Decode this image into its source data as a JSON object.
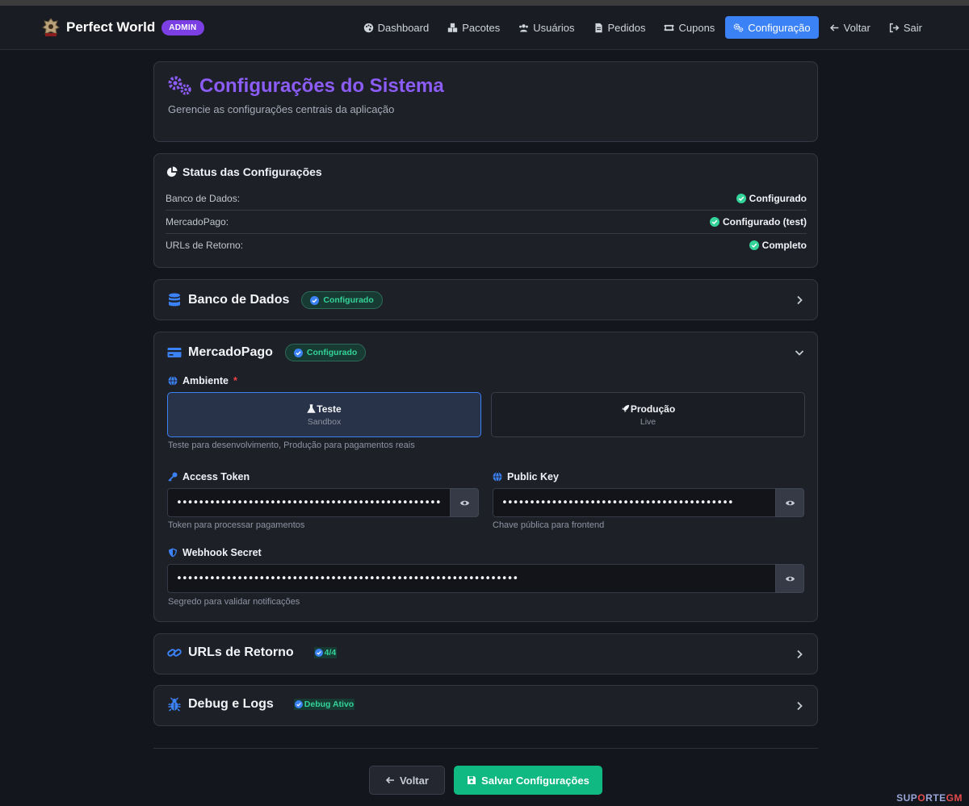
{
  "navbar": {
    "brand": "Perfect World",
    "badge": "ADMIN",
    "links": [
      {
        "label": "Dashboard",
        "icon": "palette-icon"
      },
      {
        "label": "Pacotes",
        "icon": "boxes-icon"
      },
      {
        "label": "Usuários",
        "icon": "users-icon"
      },
      {
        "label": "Pedidos",
        "icon": "file-icon"
      },
      {
        "label": "Cupons",
        "icon": "ticket-icon"
      },
      {
        "label": "Configuração",
        "icon": "gears-icon",
        "active": true
      },
      {
        "label": "Voltar",
        "icon": "arrow-left-icon"
      },
      {
        "label": "Sair",
        "icon": "sign-out-icon"
      }
    ]
  },
  "header": {
    "title": "Configurações do Sistema",
    "subtitle": "Gerencie as configurações centrais da aplicação"
  },
  "status": {
    "title": "Status das Configurações",
    "rows": [
      {
        "label": "Banco de Dados:",
        "value": "Configurado"
      },
      {
        "label": "MercadoPago:",
        "value": "Configurado (test)"
      },
      {
        "label": "URLs de Retorno:",
        "value": "Completo"
      }
    ]
  },
  "sections": {
    "database": {
      "title": "Banco de Dados",
      "badge": "Configurado"
    },
    "mercadopago": {
      "title": "MercadoPago",
      "badge": "Configurado",
      "env_label": "Ambiente",
      "required_mark": "*",
      "env_options": [
        {
          "label": "Teste",
          "sub": "Sandbox",
          "selected": true
        },
        {
          "label": "Produção",
          "sub": "Live",
          "selected": false
        }
      ],
      "env_hint": "Teste para desenvolvimento, Produção para pagamentos reais",
      "access_token": {
        "label": "Access Token",
        "value": "••••••••••••••••••••••••••••••••••••••••••••••••••••••••••••••",
        "hint": "Token para processar pagamentos"
      },
      "public_key": {
        "label": "Public Key",
        "value": "••••••••••••••••••••••••••••••••••••••••••",
        "hint": "Chave pública para frontend"
      },
      "webhook_secret": {
        "label": "Webhook Secret",
        "value": "••••••••••••••••••••••••••••••••••••••••••••••••••••••••••••••",
        "hint": "Segredo para validar notificações"
      }
    },
    "urls": {
      "title": "URLs de Retorno",
      "badge": "4/4"
    },
    "debug": {
      "title": "Debug e Logs",
      "badge": "Debug Ativo"
    }
  },
  "actions": {
    "back": "Voltar",
    "save": "Salvar Configurações"
  },
  "watermark": {
    "part1": "SUP",
    "part2": "O",
    "part3": "RTE",
    "part4": "GM"
  },
  "colors": {
    "accent": "#3b82f6",
    "purple": "#8b5cf6",
    "success": "#10b981"
  }
}
